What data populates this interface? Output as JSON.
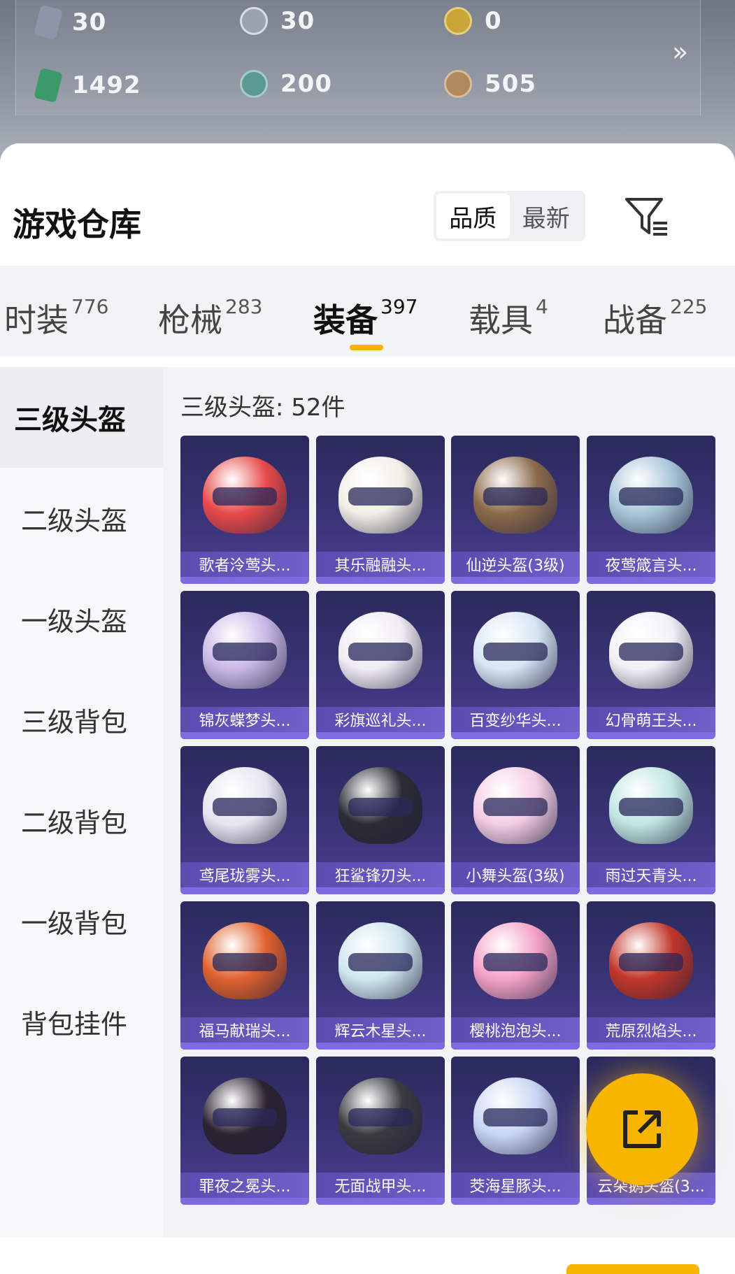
{
  "currencies": [
    {
      "icon": "silver-card-icon",
      "value": "30",
      "color": "#8d96a8"
    },
    {
      "icon": "silver-coin-icon",
      "value": "30",
      "color": "#9aa2ad"
    },
    {
      "icon": "gold-coin-icon",
      "value": "0",
      "color": "#c9a53a"
    },
    {
      "icon": "green-card-icon",
      "value": "1492",
      "color": "#3c9a6a"
    },
    {
      "icon": "teal-coin-icon",
      "value": "200",
      "color": "#5a9a95"
    },
    {
      "icon": "bronze-coin-icon",
      "value": "505",
      "color": "#b08a5e"
    }
  ],
  "more_icon": "double-chevron-right-icon",
  "title": "游戏仓库",
  "sort": {
    "options": [
      "品质",
      "最新"
    ],
    "selected": "品质"
  },
  "filter_icon": "filter-icon",
  "tabs": [
    {
      "label": "时装",
      "count": "776"
    },
    {
      "label": "枪械",
      "count": "283"
    },
    {
      "label": "装备",
      "count": "397",
      "active": true
    },
    {
      "label": "载具",
      "count": "4"
    },
    {
      "label": "战备",
      "count": "225"
    }
  ],
  "sidebar": {
    "items": [
      "三级头盔",
      "二级头盔",
      "一级头盔",
      "三级背包",
      "二级背包",
      "一级背包",
      "背包挂件"
    ],
    "active": "三级头盔"
  },
  "grid": {
    "title": "三级头盔: 52件",
    "items": [
      {
        "name": "歌者泠莺头...",
        "color": "#e84a4a"
      },
      {
        "name": "其乐融融头...",
        "color": "#f2efe6"
      },
      {
        "name": "仙逆头盔(3级)",
        "color": "#8a6a4a"
      },
      {
        "name": "夜莺箴言头...",
        "color": "#a7c6d8"
      },
      {
        "name": "锦灰蝶梦头...",
        "color": "#c8b8e6"
      },
      {
        "name": "彩旗巡礼头...",
        "color": "#f0ecf4"
      },
      {
        "name": "百变纱华头...",
        "color": "#d6e6f4"
      },
      {
        "name": "幻骨萌王头...",
        "color": "#f2f0f6"
      },
      {
        "name": "鸢尾珑雾头...",
        "color": "#e4e6f0"
      },
      {
        "name": "狂鲨锋刃头...",
        "color": "#2a2c34"
      },
      {
        "name": "小舞头盔(3级)",
        "color": "#f4cde4"
      },
      {
        "name": "雨过天青头...",
        "color": "#bfe6e2"
      },
      {
        "name": "福马献瑞头...",
        "color": "#e0612e"
      },
      {
        "name": "辉云木星头...",
        "color": "#cfe6ee"
      },
      {
        "name": "樱桃泡泡头...",
        "color": "#f4a2c6"
      },
      {
        "name": "荒原烈焰头...",
        "color": "#c2362a"
      },
      {
        "name": "罪夜之冕头...",
        "color": "#2c2230"
      },
      {
        "name": "无面战甲头...",
        "color": "#3a3a40"
      },
      {
        "name": "茭海星豚头...",
        "color": "#c8d6f4"
      },
      {
        "name": "云朵鹅头盔(3...",
        "color": "#e8eef6"
      }
    ]
  },
  "fab_icon": "share-export-icon",
  "accent": "#f7b500"
}
